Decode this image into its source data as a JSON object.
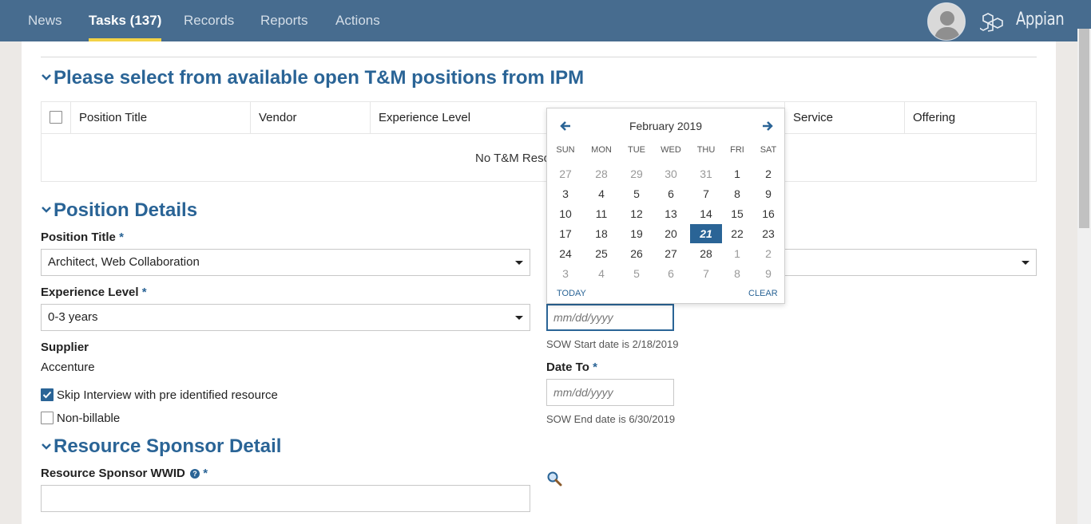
{
  "nav": {
    "tabs": [
      "News",
      "Tasks (137)",
      "Reports",
      "Actions"
    ],
    "records": "Records",
    "brand": "Appian"
  },
  "sections": {
    "positions_title": "Please select from available open T&M positions from IPM",
    "details_title": "Position Details",
    "sponsor_title": "Resource Sponsor Detail"
  },
  "grid": {
    "columns": [
      "Position Title",
      "Vendor",
      "Experience Level",
      "Service",
      "Offering"
    ],
    "empty_text": "No T&M Reso"
  },
  "form": {
    "position_title_label": "Position Title",
    "position_title_value": "Architect, Web Collaboration",
    "experience_label": "Experience Level",
    "experience_value": "0-3 years",
    "supplier_label": "Supplier",
    "supplier_value": "Accenture",
    "skip_interview_label": "Skip Interview with pre identified resource",
    "skip_interview_checked": true,
    "non_billable_label": "Non-billable",
    "non_billable_checked": false,
    "required_mark": "*",
    "date_from_placeholder": "mm/dd/yyyy",
    "sow_start_hint": "SOW Start date is 2/18/2019",
    "date_to_label": "Date To",
    "date_to_placeholder": "mm/dd/yyyy",
    "sow_end_hint": "SOW End date is 6/30/2019",
    "sponsor_wwid_label": "Resource Sponsor WWID",
    "help_icon_glyph": "?"
  },
  "datepicker": {
    "month_label": "February 2019",
    "weekdays": [
      "SUN",
      "MON",
      "TUE",
      "WED",
      "THU",
      "FRI",
      "SAT"
    ],
    "weeks": [
      [
        "27",
        "28",
        "29",
        "30",
        "31",
        "1",
        "2"
      ],
      [
        "3",
        "4",
        "5",
        "6",
        "7",
        "8",
        "9"
      ],
      [
        "10",
        "11",
        "12",
        "13",
        "14",
        "15",
        "16"
      ],
      [
        "17",
        "18",
        "19",
        "20",
        "21",
        "22",
        "23"
      ],
      [
        "24",
        "25",
        "26",
        "27",
        "28",
        "1",
        "2"
      ],
      [
        "3",
        "4",
        "5",
        "6",
        "7",
        "8",
        "9"
      ]
    ],
    "selected_day": "21",
    "today_label": "TODAY",
    "clear_label": "CLEAR"
  },
  "colors": {
    "nav_bg": "#476c8f",
    "active_underline": "#f3d246",
    "accent": "#2a6496"
  },
  "icons": [
    "chevron-down-icon",
    "arrow-left-icon",
    "arrow-right-icon",
    "magnifier-icon",
    "user-avatar-icon",
    "appian-cubes-icon",
    "caret-down-icon",
    "checkmark-icon",
    "help-icon"
  ]
}
